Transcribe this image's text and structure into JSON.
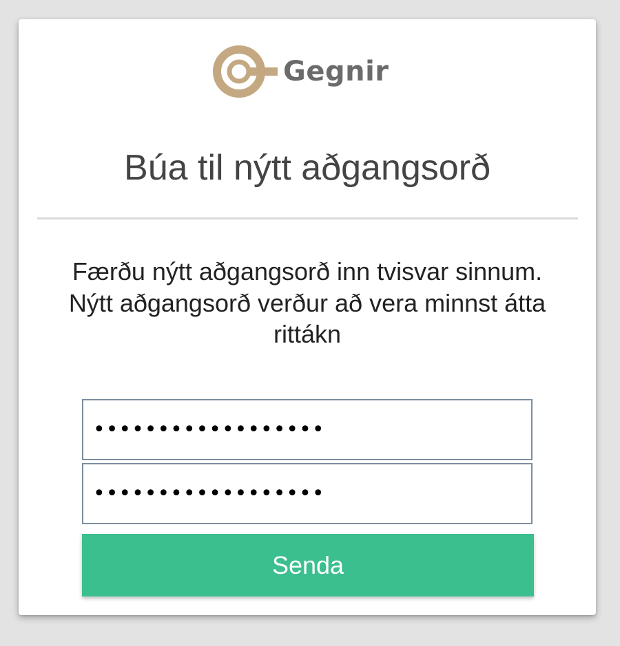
{
  "brand": {
    "name": "Gegnir",
    "logo_icon": "key-ring-icon",
    "logo_color": "#c4a882"
  },
  "page": {
    "title": "Búa til nýtt aðgangsorð",
    "instructions": "Færðu nýtt aðgangsorð inn tvisvar sinnum. Nýtt aðgangsorð verður að vera minnst átta rittákn"
  },
  "form": {
    "password_value": "••••••••••••••••••",
    "confirm_value": "••••••••••••••••••",
    "submit_label": "Senda",
    "submit_color": "#3bbf8f"
  }
}
